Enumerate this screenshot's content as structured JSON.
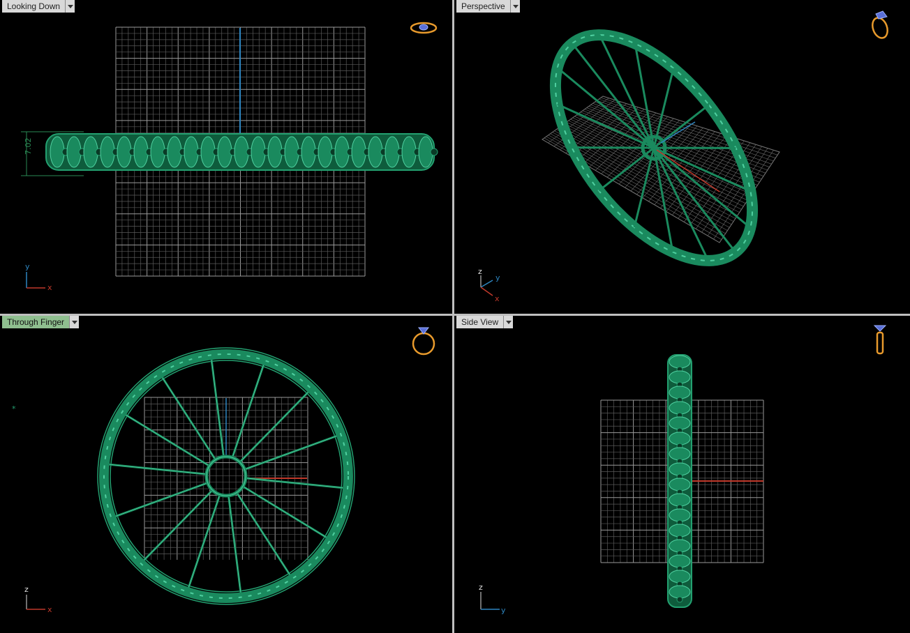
{
  "viewports": {
    "top_left": {
      "label": "Looking Down",
      "active": false,
      "axes": [
        "y",
        "x"
      ],
      "dimension": "7.02"
    },
    "top_right": {
      "label": "Perspective",
      "active": false,
      "axes": [
        "z",
        "y",
        "x"
      ]
    },
    "bottom_left": {
      "label": "Through Finger",
      "active": true,
      "axes": [
        "z",
        "x"
      ]
    },
    "bottom_right": {
      "label": "Side View",
      "active": false,
      "axes": [
        "z",
        "y"
      ]
    }
  },
  "colors": {
    "model": "#1a8a5e",
    "model_highlight": "#4fd0a0",
    "grid": "#8a8a8a",
    "axis_x": "#c0392b",
    "axis_y": "#2e86c1",
    "widget": "#e89a2c"
  },
  "icons": [
    "ring-top-icon",
    "ring-perspective-icon",
    "ring-front-icon",
    "ring-side-icon"
  ]
}
